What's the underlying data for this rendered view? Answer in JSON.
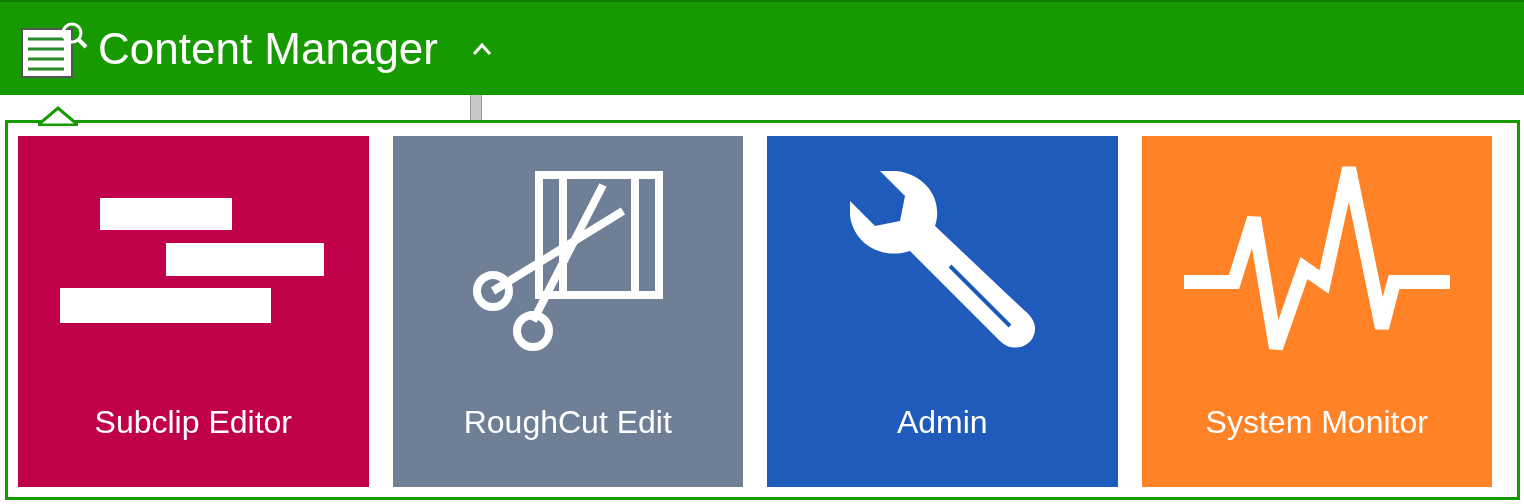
{
  "header": {
    "title": "Content Manager",
    "expanded": true
  },
  "tiles": [
    {
      "label": "Subclip Editor",
      "color": "#c0004a",
      "kind": "subclip"
    },
    {
      "label": "RoughCut Edit",
      "color": "#6e7f96",
      "kind": "roughcut"
    },
    {
      "label": "Admin",
      "color": "#1f5bbb",
      "kind": "admin"
    },
    {
      "label": "System Monitor",
      "color": "#ff8226",
      "kind": "monitor"
    }
  ]
}
